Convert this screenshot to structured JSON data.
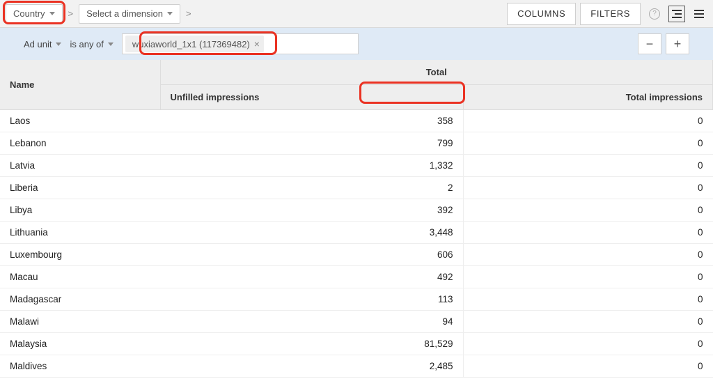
{
  "toolbar": {
    "dim_primary": "Country",
    "dim_secondary": "Select a dimension",
    "columns_btn": "COLUMNS",
    "filters_btn": "FILTERS"
  },
  "filter": {
    "field": "Ad unit",
    "op": "is any of",
    "chip": "wuxiaworld_1x1 (117369482)"
  },
  "table": {
    "group_header": "Total",
    "col_name": "Name",
    "col_unfilled": "Unfilled impressions",
    "col_total": "Total impressions",
    "rows": [
      {
        "name": "Laos",
        "unfilled": "358",
        "total": "0"
      },
      {
        "name": "Lebanon",
        "unfilled": "799",
        "total": "0"
      },
      {
        "name": "Latvia",
        "unfilled": "1,332",
        "total": "0"
      },
      {
        "name": "Liberia",
        "unfilled": "2",
        "total": "0"
      },
      {
        "name": "Libya",
        "unfilled": "392",
        "total": "0"
      },
      {
        "name": "Lithuania",
        "unfilled": "3,448",
        "total": "0"
      },
      {
        "name": "Luxembourg",
        "unfilled": "606",
        "total": "0"
      },
      {
        "name": "Macau",
        "unfilled": "492",
        "total": "0"
      },
      {
        "name": "Madagascar",
        "unfilled": "113",
        "total": "0"
      },
      {
        "name": "Malawi",
        "unfilled": "94",
        "total": "0"
      },
      {
        "name": "Malaysia",
        "unfilled": "81,529",
        "total": "0"
      },
      {
        "name": "Maldives",
        "unfilled": "2,485",
        "total": "0"
      }
    ]
  }
}
